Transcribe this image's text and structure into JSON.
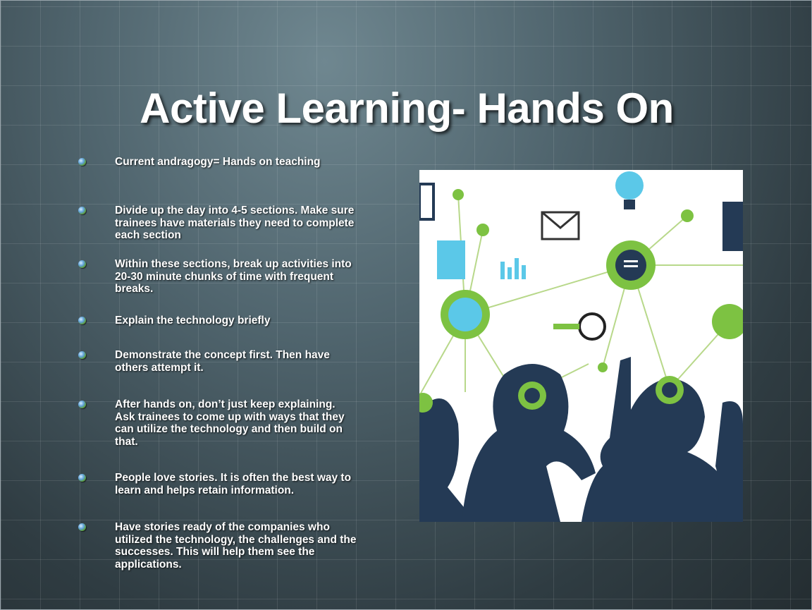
{
  "slide": {
    "title": "Active Learning- Hands On",
    "bullets": [
      {
        "lines": [
          "Current andragogy= Hands on teaching"
        ]
      },
      {
        "lines": [
          "Divide up the day into 4-5 sections.  Make sure",
          "trainees have materials they need to complete",
          "each section"
        ]
      },
      {
        "lines": [
          "Within these sections, break up activities into",
          "20-30 minute chunks of time with frequent",
          "breaks."
        ]
      },
      {
        "lines": [
          "Explain the technology briefly"
        ]
      },
      {
        "lines": [
          "Demonstrate the concept first.  Then have",
          "others attempt it."
        ]
      },
      {
        "lines": [
          "After hands on, don’t just keep explaining.",
          "Ask trainees to come up with ways that they",
          "can utilize the technology and then build on",
          "that."
        ]
      },
      {
        "lines": [
          "People love stories.  It is often the best way to",
          "learn and helps retain information."
        ]
      },
      {
        "lines": [
          "Have stories ready of the companies who",
          "utilized the technology, the challenges and the",
          "successes.  This will help them see the",
          "applications."
        ]
      }
    ],
    "colors": {
      "accent_green": "#7dc242",
      "silhouette": "#243a55",
      "icon_blue": "#5bc8e8"
    }
  }
}
